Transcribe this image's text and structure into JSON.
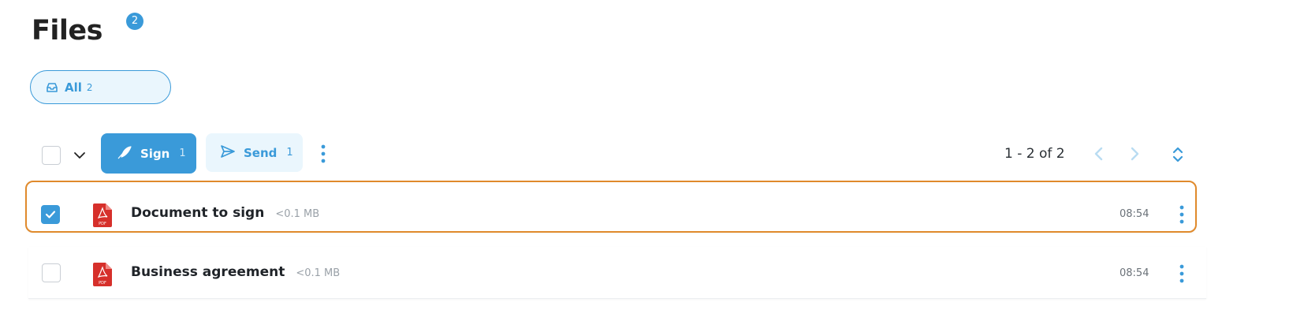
{
  "header": {
    "title": "Files",
    "badge": "2"
  },
  "filter": {
    "label": "All",
    "count": "2",
    "icon": "inbox-icon"
  },
  "toolbar": {
    "sign_label": "Sign",
    "sign_count": "1",
    "send_label": "Send",
    "send_count": "1",
    "pagination": "1 - 2 of 2"
  },
  "files": [
    {
      "name": "Document to sign",
      "size": "<0.1 MB",
      "time": "08:54",
      "selected": true,
      "icon": "pdf-icon"
    },
    {
      "name": "Business agreement",
      "size": "<0.1 MB",
      "time": "08:54",
      "selected": false,
      "icon": "pdf-icon"
    }
  ],
  "colors": {
    "accent": "#3a9ad9",
    "accent_light": "#eaf6fd",
    "selection": "#e08a2c",
    "pdf_red": "#d6302b"
  }
}
